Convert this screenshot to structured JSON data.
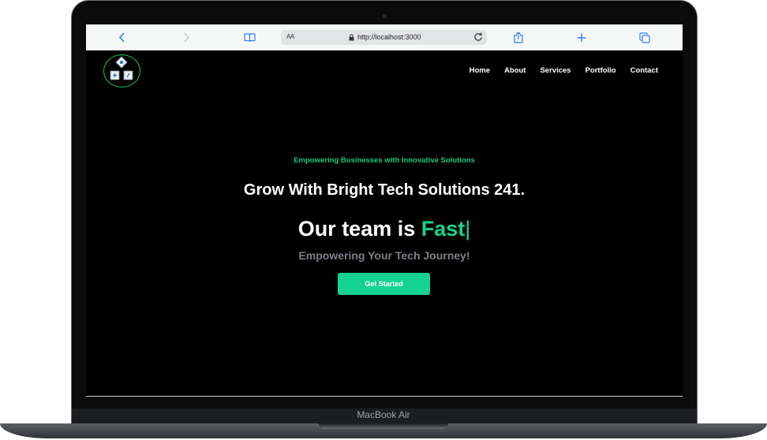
{
  "device": {
    "label": "MacBook Air"
  },
  "browser": {
    "text_size_label": "AA",
    "url": "http://localhost:3000",
    "icons": {
      "back": "chevron-left-icon",
      "forward": "chevron-right-icon",
      "bookmarks": "book-icon",
      "lock": "lock-icon",
      "reload": "reload-icon",
      "share": "share-icon",
      "new_tab": "plus-icon",
      "tabs": "tabs-icon"
    }
  },
  "site": {
    "logo_icon": "company-logo-icon",
    "nav": {
      "home": "Home",
      "about": "About",
      "services": "Services",
      "portfolio": "Portfolio",
      "contact": "Contact"
    },
    "hero": {
      "eyebrow": "Empowering Businesses with Innovative Solutions",
      "headline": "Grow With Bright Tech Solutions 241.",
      "team_prefix": "Our team is",
      "team_word": "Fast",
      "cursor": "|",
      "tagline": "Empowering Your Tech Journey!",
      "cta": "Get Started"
    }
  },
  "colors": {
    "accent": "#14d392",
    "accent_text": "#17c97f",
    "background": "#000000",
    "safari_blue": "#2f80ed"
  }
}
